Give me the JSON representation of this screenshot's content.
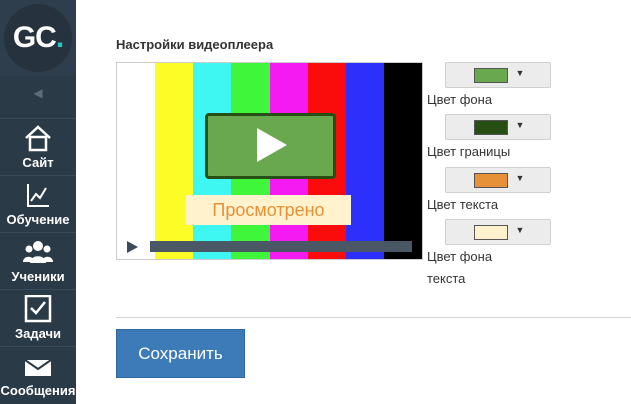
{
  "sidebar": {
    "logo": {
      "letters": "GC",
      "dot": "."
    },
    "collapse_icon": "speaker-icon",
    "items": [
      {
        "label": "Сайт",
        "icon": "home-icon"
      },
      {
        "label": "Обучение",
        "icon": "chart-icon"
      },
      {
        "label": "Ученики",
        "icon": "users-icon"
      },
      {
        "label": "Задачи",
        "icon": "checkbox-icon"
      },
      {
        "label": "Сообщения",
        "icon": "envelope-icon"
      }
    ]
  },
  "main": {
    "title": "Настройки видеоплеера",
    "player": {
      "stripe_colors": [
        "#ffffff",
        "#fcfc27",
        "#3ef7f3",
        "#40f63b",
        "#f41af1",
        "#fb0c0c",
        "#2d2ffb",
        "#000000"
      ],
      "watched_label": "Просмотрено"
    },
    "settings": [
      {
        "label": "Цвет фона",
        "color": "#6aa84f"
      },
      {
        "label": "Цвет границы",
        "color": "#274e13"
      },
      {
        "label": "Цвет текста",
        "color": "#e69138"
      },
      {
        "label": "Цвет фона текста",
        "color": "#fff2cc"
      }
    ],
    "save_label": "Сохранить"
  }
}
